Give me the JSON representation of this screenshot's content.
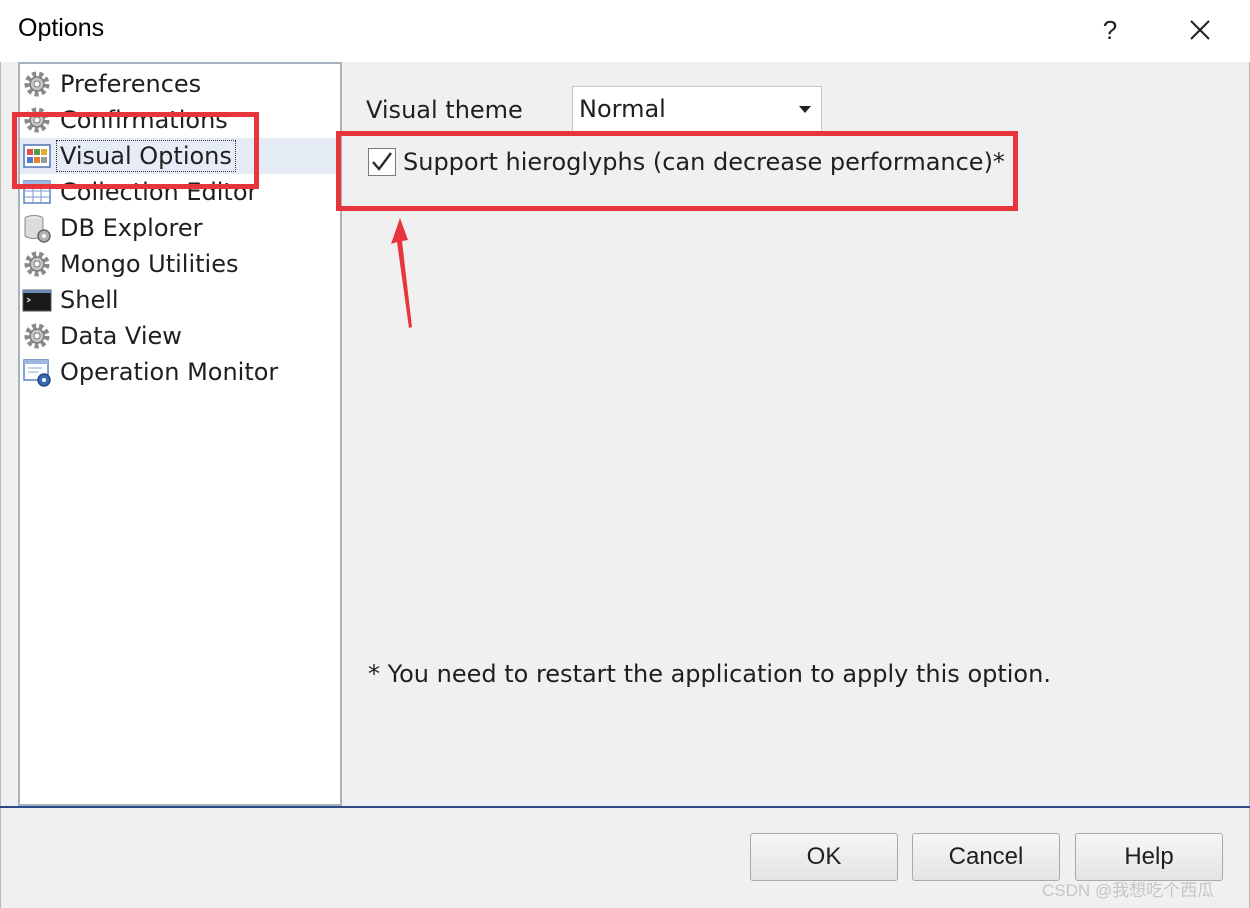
{
  "window": {
    "title": "Options",
    "help_label": "?"
  },
  "tree": {
    "items": [
      {
        "label": "Preferences",
        "icon": "gear-icon"
      },
      {
        "label": "Confirmations",
        "icon": "gear-icon"
      },
      {
        "label": "Visual Options",
        "icon": "visual-grid-icon",
        "selected": true
      },
      {
        "label": "Collection Editor",
        "icon": "table-grid-icon"
      },
      {
        "label": "DB Explorer",
        "icon": "database-gear-icon"
      },
      {
        "label": "Mongo Utilities",
        "icon": "gear-icon"
      },
      {
        "label": "Shell",
        "icon": "terminal-icon"
      },
      {
        "label": "Data View",
        "icon": "gear-icon"
      },
      {
        "label": "Operation Monitor",
        "icon": "monitor-gear-icon"
      }
    ]
  },
  "visual_options": {
    "theme_label": "Visual theme",
    "theme_value": "Normal",
    "hieroglyphs_label": "Support hieroglyphs (can decrease performance)*",
    "hieroglyphs_checked": true,
    "restart_note": "* You need to restart the application to apply this option."
  },
  "buttons": {
    "ok": "OK",
    "cancel": "Cancel",
    "help": "Help"
  },
  "watermark": "CSDN @我想吃个西瓜",
  "colors": {
    "highlight": "#e8353b",
    "separator": "#2c4a88",
    "selection": "#e6ecf6"
  }
}
